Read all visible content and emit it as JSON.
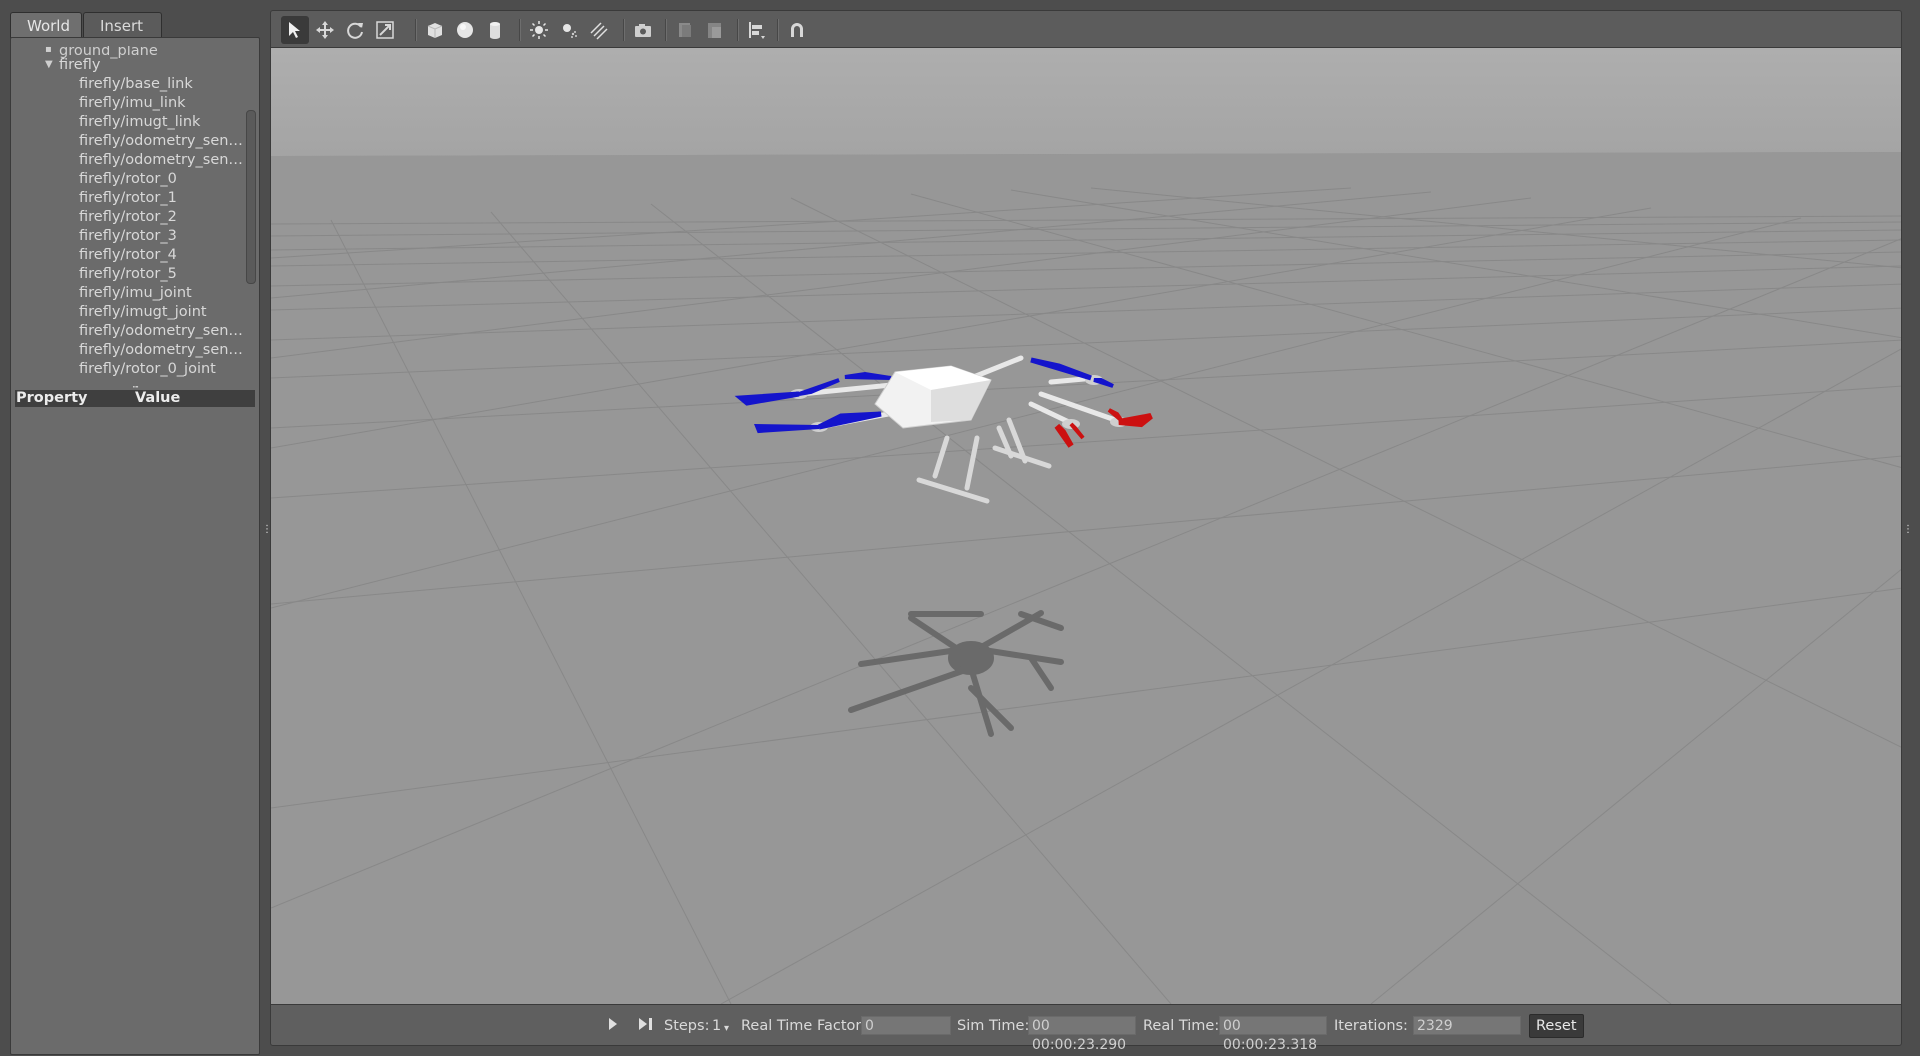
{
  "tabs": [
    {
      "label": "World"
    },
    {
      "label": "Insert"
    }
  ],
  "tree": {
    "partial_item": "ground_plane",
    "parent": "firefly",
    "items": [
      "firefly/base_link",
      "firefly/imu_link",
      "firefly/imugt_link",
      "firefly/odometry_sen…",
      "firefly/odometry_sen…",
      "firefly/rotor_0",
      "firefly/rotor_1",
      "firefly/rotor_2",
      "firefly/rotor_3",
      "firefly/rotor_4",
      "firefly/rotor_5",
      "firefly/imu_joint",
      "firefly/imugt_joint",
      "firefly/odometry_sen…",
      "firefly/odometry_sen…",
      "firefly/rotor_0_joint"
    ]
  },
  "properties": {
    "col_property": "Property",
    "col_value": "Value"
  },
  "toolbar": {
    "tools": [
      "select-arrow-icon",
      "translate-icon",
      "rotate-icon",
      "scale-icon",
      "box-icon",
      "sphere-icon",
      "cylinder-icon",
      "point-light-icon",
      "spot-light-icon",
      "directional-light-icon",
      "camera-icon",
      "copy-icon",
      "paste-icon",
      "align-icon",
      "magnet-icon"
    ]
  },
  "status": {
    "steps_label": "Steps:",
    "steps_value": "1",
    "rtf_label": "Real Time Factor:",
    "rtf_value": "0",
    "sim_time_label": "Sim Time:",
    "sim_time_value": "00 00:00:23.290",
    "real_time_label": "Real Time:",
    "real_time_value": "00 00:00:23.318",
    "iterations_label": "Iterations:",
    "iterations_value": "2329",
    "reset_label": "Reset"
  },
  "colors": {
    "sky": "#aaaaaa",
    "ground": "#959595",
    "rotor_blue": "#1010d0",
    "rotor_red": "#d01010"
  }
}
